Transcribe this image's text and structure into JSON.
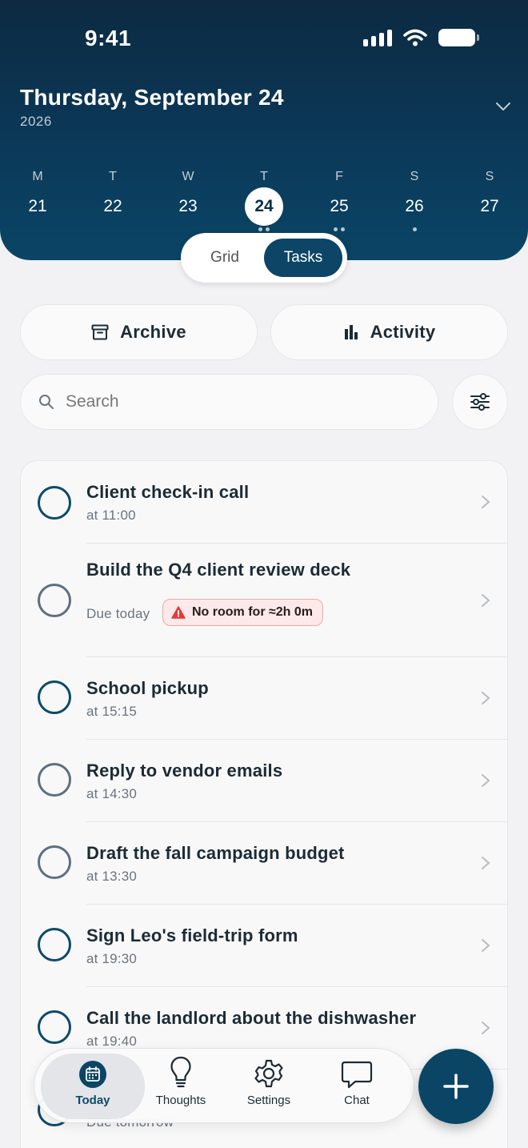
{
  "status_bar": {
    "time": "9:41"
  },
  "header": {
    "date_title": "Thursday, September 24",
    "year": "2026",
    "week": [
      {
        "letter": "M",
        "num": "21",
        "dots": 0
      },
      {
        "letter": "T",
        "num": "22",
        "dots": 0
      },
      {
        "letter": "W",
        "num": "23",
        "dots": 0
      },
      {
        "letter": "T",
        "num": "24",
        "dots": 2,
        "active": true
      },
      {
        "letter": "F",
        "num": "25",
        "dots": 2
      },
      {
        "letter": "S",
        "num": "26",
        "dots": 1
      },
      {
        "letter": "S",
        "num": "27",
        "dots": 0
      }
    ]
  },
  "view_toggle": {
    "grid_label": "Grid",
    "tasks_label": "Tasks"
  },
  "actions": {
    "archive_label": "Archive",
    "activity_label": "Activity"
  },
  "search": {
    "placeholder": "Search"
  },
  "tasks": [
    {
      "title": "Client check-in call",
      "sub": "at 11:00"
    },
    {
      "title": "Build the Q4 client review deck",
      "sub": "Due today",
      "warning": "No room for ≈2h 0m"
    },
    {
      "title": "School pickup",
      "sub": "at 15:15"
    },
    {
      "title": "Reply to vendor emails",
      "sub": "at 14:30"
    },
    {
      "title": "Draft the fall campaign budget",
      "sub": "at 13:30"
    },
    {
      "title": "Sign Leo's field-trip form",
      "sub": "at 19:30"
    },
    {
      "title": "Call the landlord about the dishwasher",
      "sub": "at 19:40"
    },
    {
      "title": "",
      "sub": "Due tomorrow"
    }
  ],
  "tabbar": {
    "today_label": "Today",
    "thoughts_label": "Thoughts",
    "settings_label": "Settings",
    "chat_label": "Chat"
  },
  "colors": {
    "primary": "#0b4566",
    "header_dark": "#0c2a42",
    "warning_bg": "#fde9e9",
    "warning_border": "#f2a6a6"
  }
}
